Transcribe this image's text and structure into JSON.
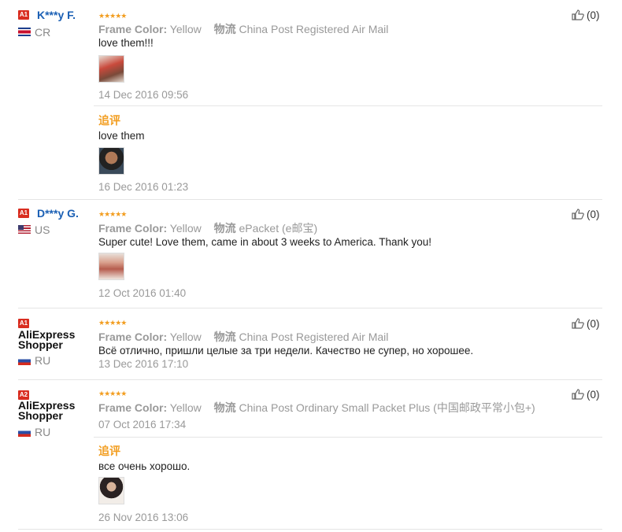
{
  "reviews": [
    {
      "badge": "A1",
      "username": "K***y F.",
      "country": "CR",
      "rating": "★★★★★",
      "attr_label": "Frame Color:",
      "attr_value": "Yellow",
      "logistics_label": "物流",
      "logistics_value": "China Post Registered Air Mail",
      "text": "love them!!!",
      "date": "14 Dec 2016 09:56",
      "likes": "(0)",
      "followup": {
        "label": "追评",
        "text": "love them",
        "date": "16 Dec 2016 01:23"
      }
    },
    {
      "badge": "A1",
      "username": "D***y G.",
      "country": "US",
      "rating": "★★★★★",
      "attr_label": "Frame Color:",
      "attr_value": "Yellow",
      "logistics_label": "物流",
      "logistics_value": "ePacket (e邮宝)",
      "text": "Super cute! Love them, came in about 3 weeks to America. Thank you!",
      "date": "12 Oct 2016 01:40",
      "likes": "(0)"
    },
    {
      "badge": "A1",
      "username_line1": "AliExpress",
      "username_line2": "Shopper",
      "country": "RU",
      "rating": "★★★★★",
      "attr_label": "Frame Color:",
      "attr_value": "Yellow",
      "logistics_label": "物流",
      "logistics_value": "China Post Registered Air Mail",
      "text": "Всё отлично, пришли целые за три недели. Качество не супер, но хорошее.",
      "date": "13 Dec 2016 17:10",
      "likes": "(0)"
    },
    {
      "badge": "A2",
      "username_line1": "AliExpress",
      "username_line2": "Shopper",
      "country": "RU",
      "rating": "★★★★★",
      "attr_label": "Frame Color:",
      "attr_value": "Yellow",
      "logistics_label": "物流",
      "logistics_value": "China Post Ordinary Small Packet Plus (中国邮政平常小包+)",
      "date": "07 Oct 2016 17:34",
      "likes": "(0)",
      "followup": {
        "label": "追评",
        "text": "все очень хорошо.",
        "date": "26 Nov 2016 13:06"
      }
    }
  ],
  "colors": {
    "accent": "#f29d1f",
    "username": "#1a5fb4",
    "badge": "#d92d20"
  }
}
